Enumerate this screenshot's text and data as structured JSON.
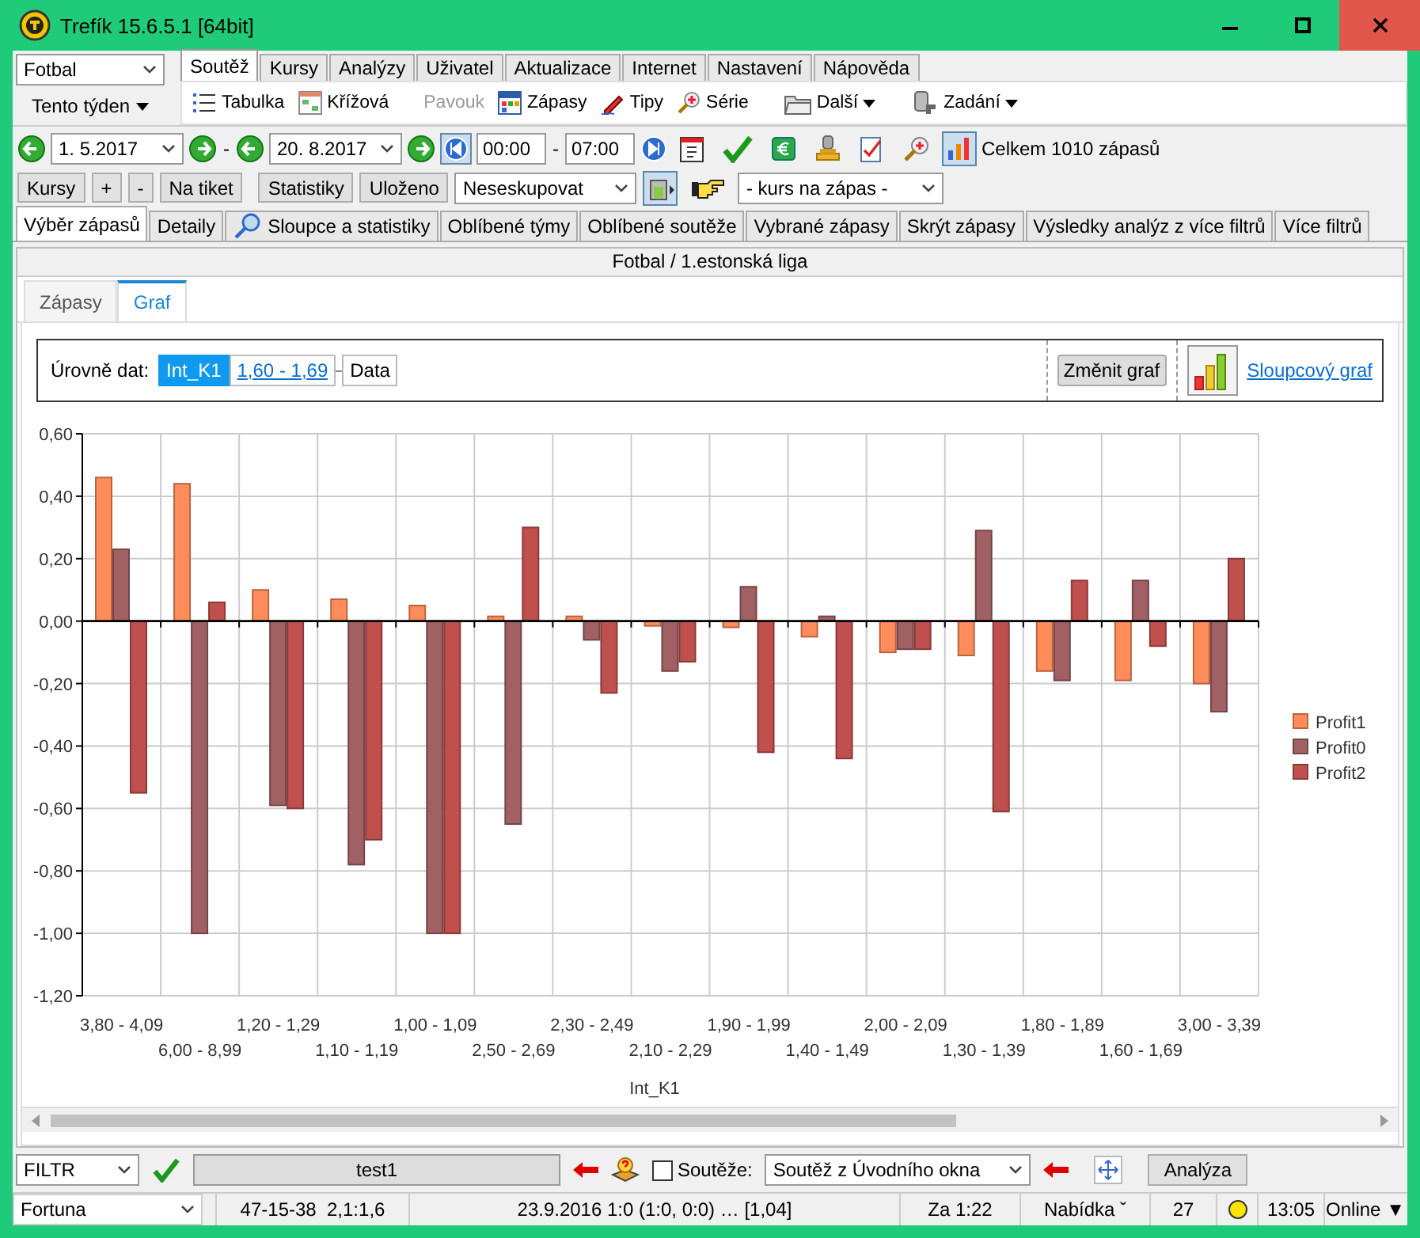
{
  "window": {
    "title": "Trefík 15.6.5.1 [64bit]"
  },
  "sport_select": {
    "value": "Fotbal"
  },
  "menu_tabs": [
    {
      "label": "Soutěž",
      "selected": true
    },
    {
      "label": "Kursy",
      "selected": false
    },
    {
      "label": "Analýzy",
      "selected": false
    },
    {
      "label": "Uživatel",
      "selected": false
    },
    {
      "label": "Aktualizace",
      "selected": false
    },
    {
      "label": "Internet",
      "selected": false
    },
    {
      "label": "Nastavení",
      "selected": false
    },
    {
      "label": "Nápověda",
      "selected": false
    }
  ],
  "period_button": {
    "label": "Tento týden"
  },
  "toolbar": [
    {
      "label": "Tabulka",
      "kind": "list",
      "disabled": false,
      "dropdown": false
    },
    {
      "label": "Křížová",
      "kind": "grid",
      "disabled": false,
      "dropdown": false
    },
    {
      "label": "Pavouk",
      "kind": "none",
      "disabled": true,
      "dropdown": false
    },
    {
      "label": "Zápasy",
      "kind": "calendar",
      "disabled": false,
      "dropdown": false
    },
    {
      "label": "Tipy",
      "kind": "pencil",
      "disabled": false,
      "dropdown": false
    },
    {
      "label": "Série",
      "kind": "magnifier",
      "disabled": false,
      "dropdown": false
    },
    {
      "label": "Další",
      "kind": "folder",
      "disabled": false,
      "dropdown": true
    },
    {
      "label": "Zadání",
      "kind": "users",
      "disabled": false,
      "dropdown": true
    }
  ],
  "date_filter": {
    "from": "1.  5.2017",
    "date_separator": "-",
    "to": "20.  8.2017",
    "time_from": "00:00",
    "time_separator": "-",
    "time_to": "07:00",
    "total": "Celkem 1010 zápasů"
  },
  "action_buttons": [
    "Kursy",
    "+",
    "-",
    "Na tiket"
  ],
  "stat_buttons": [
    "Statistiky",
    "Uloženo"
  ],
  "grouping_select": {
    "value": "Neseskupovat"
  },
  "odds_select": {
    "value": "- kurs na zápas -"
  },
  "tabs": [
    {
      "label": "Výběr zápasů",
      "selected": true,
      "kind": "plain"
    },
    {
      "label": "Detaily",
      "selected": false,
      "kind": "plain"
    },
    {
      "label": "Sloupce a statistiky",
      "selected": false,
      "kind": "racket"
    },
    {
      "label": "Oblíbené týmy",
      "selected": false,
      "kind": "plain"
    },
    {
      "label": "Oblíbené soutěže",
      "selected": false,
      "kind": "plain"
    },
    {
      "label": "Vybrané zápasy",
      "selected": false,
      "kind": "plain"
    },
    {
      "label": "Skrýt zápasy",
      "selected": false,
      "kind": "plain"
    },
    {
      "label": "Výsledky analýz z více filtrů",
      "selected": false,
      "kind": "plain"
    },
    {
      "label": "Více filtrů",
      "selected": false,
      "kind": "plain"
    }
  ],
  "panel": {
    "title": "Fotbal / 1.estonská liga",
    "sub_tabs": [
      {
        "label": "Zápasy",
        "selected": false
      },
      {
        "label": "Graf",
        "selected": true
      }
    ],
    "levels_label": "Úrovně dat:",
    "levels": [
      {
        "label": "Int_K1",
        "kind": "current"
      },
      {
        "label": "1,60 - 1,69",
        "kind": "link"
      },
      {
        "label": "Data",
        "kind": "plain"
      }
    ],
    "change_chart_button": "Změnit graf",
    "chart_type_link": "Sloupcový graf",
    "chart_data": {
      "type": "bar",
      "xlabel": "Int_K1",
      "grid": true,
      "legend": true,
      "categories": [
        "3,80 - 4,09",
        "6,00 - 8,99",
        "1,20 - 1,29",
        "1,10 - 1,19",
        "1,00 - 1,09",
        "2,50 - 2,69",
        "2,30 - 2,49",
        "2,10 - 2,29",
        "1,90 - 1,99",
        "1,40 - 1,49",
        "2,00 - 2,09",
        "1,30 - 1,39",
        "1,80 - 1,89",
        "1,60 - 1,69",
        "3,00 - 3,39"
      ],
      "series": [
        {
          "name": "Profit1",
          "color": "#ff8c5a",
          "values": [
            0.46,
            0.44,
            0.1,
            0.07,
            0.05,
            0.01,
            0.01,
            -0.01,
            -0.02,
            -0.05,
            -0.1,
            -0.11,
            -0.16,
            -0.19,
            -0.2
          ]
        },
        {
          "name": "Profit0",
          "color": "#a06064",
          "values": [
            0.23,
            -1.0,
            -0.59,
            -0.78,
            -1.0,
            -0.65,
            -0.06,
            -0.16,
            0.11,
            0.01,
            -0.09,
            0.29,
            -0.19,
            0.13,
            -0.29
          ]
        },
        {
          "name": "Profit2",
          "color": "#c0504d",
          "values": [
            -0.55,
            0.06,
            -0.6,
            -0.7,
            -1.0,
            0.3,
            -0.23,
            -0.13,
            -0.42,
            -0.44,
            -0.09,
            -0.61,
            0.13,
            -0.08,
            0.2
          ]
        }
      ],
      "ylim": [
        -1.2,
        0.6
      ],
      "yticks": [
        {
          "value": 0.6,
          "label": "0,60"
        },
        {
          "value": 0.4,
          "label": "0,40"
        },
        {
          "value": 0.2,
          "label": "0,20"
        },
        {
          "value": 0,
          "label": "0,00"
        },
        {
          "value": -0.2,
          "label": "-0,20"
        },
        {
          "value": -0.4,
          "label": "-0,40"
        },
        {
          "value": -0.6,
          "label": "-0,60"
        },
        {
          "value": -0.8,
          "label": "-0,80"
        },
        {
          "value": -1.0,
          "label": "-1,00"
        },
        {
          "value": -1.2,
          "label": "-1,20"
        }
      ]
    }
  },
  "bottom_bar": {
    "filter_select": "FILTR",
    "filter_name": "test1",
    "competitions_checkbox": {
      "label": "Soutěže:",
      "checked": false
    },
    "competition_select": "Soutěž z Úvodního okna",
    "analyze_button": "Analýza"
  },
  "status_bar": {
    "bookmaker_select": "Fortuna",
    "record": "47-15-38  2,1:1,6",
    "last_match": "23.9.2016 1:0 (1:0, 0:0) … [1,04]",
    "countdown": "Za 1:22",
    "offer": "Nabídka ˇ",
    "count": "27",
    "time": "13:05",
    "connection": "Online ▼"
  }
}
